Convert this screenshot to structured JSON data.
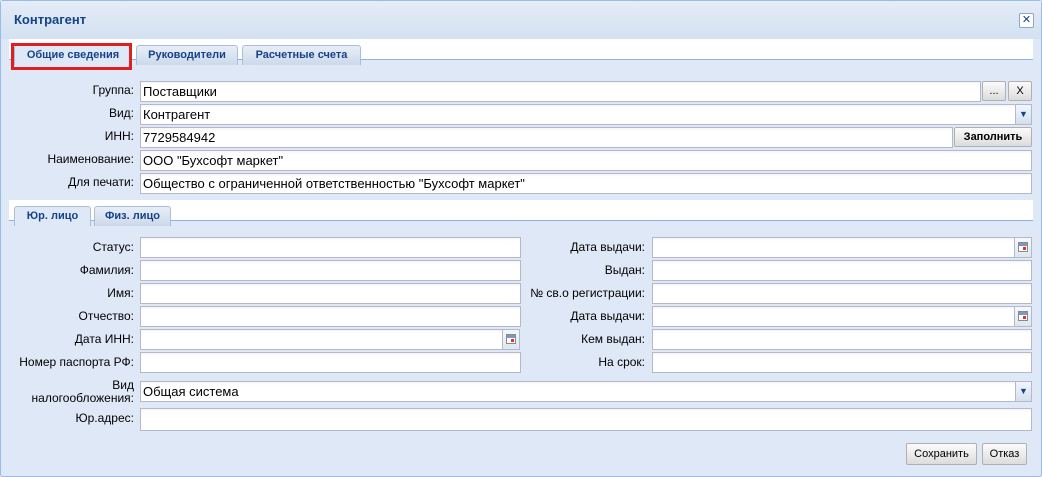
{
  "window": {
    "title": "Контрагент"
  },
  "tabs": [
    "Общие сведения",
    "Руководители",
    "Расчетные счета"
  ],
  "general": {
    "group_label": "Группа:",
    "group_value": "Поставщики",
    "browse_label": "...",
    "clear_label": "X",
    "kind_label": "Вид:",
    "kind_value": "Контрагент",
    "inn_label": "ИНН:",
    "inn_value": "7729584942",
    "fill_label": "Заполнить",
    "name_label": "Наименование:",
    "name_value": "ООО \"Бухсофт маркет\"",
    "print_label": "Для печати:",
    "print_value": "Общество с ограниченной ответственностью \"Бухсофт маркет\""
  },
  "subtabs": [
    "Юр. лицо",
    "Физ. лицо"
  ],
  "person": {
    "status_label": "Статус:",
    "status_value": "",
    "surname_label": "Фамилия:",
    "surname_value": "",
    "firstname_label": "Имя:",
    "firstname_value": "",
    "patronymic_label": "Отчество:",
    "patronymic_value": "",
    "inn_date_label": "Дата ИНН:",
    "inn_date_value": "",
    "passport_label": "Номер паспорта РФ:",
    "passport_value": "",
    "issue_date_label": "Дата выдачи:",
    "issue_date_value": "",
    "issued_label": "Выдан:",
    "issued_value": "",
    "reg_cert_label": "№ св.о регистрации:",
    "reg_cert_value": "",
    "issue_date2_label": "Дата выдачи:",
    "issue_date2_value": "",
    "issued_by_label": "Кем выдан:",
    "issued_by_value": "",
    "term_label": "На срок:",
    "term_value": ""
  },
  "tax": {
    "label_line1": "Вид",
    "label_line2": "налогообложения:",
    "value": "Общая система",
    "address_label": "Юр.адрес:",
    "address_value": ""
  },
  "footer": {
    "save_label": "Сохранить",
    "cancel_label": "Отказ"
  },
  "colors": {
    "highlight": "#e02020",
    "accent": "#15428b"
  }
}
